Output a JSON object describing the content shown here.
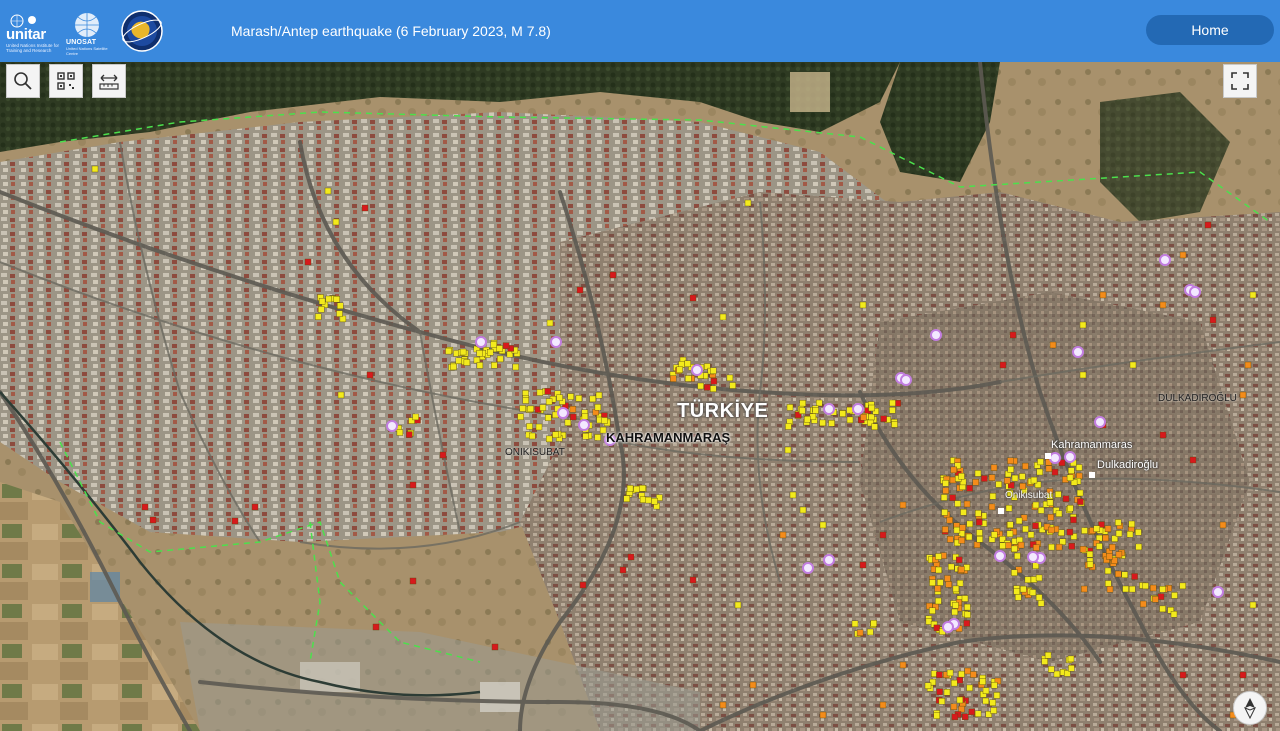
{
  "header": {
    "title": "Marash/Antep earthquake (6 February 2023, M 7.8)",
    "home_label": "Home",
    "logos": {
      "unitar_wordmark": "unitar",
      "unitar_tagline": "United Nations Institute for Training and Research",
      "unosat_wordmark": "UNOSAT",
      "unosat_tagline": "United Nations Satellite Centre"
    }
  },
  "toolbar": {
    "icons": [
      "search-icon",
      "qr-code-icon",
      "measure-icon"
    ],
    "fullscreen_icon": "fullscreen-icon",
    "compass_icon": "compass-icon"
  },
  "map": {
    "labels": {
      "country": "TÜRKİYE",
      "city": "KAHRAMANMARAŞ",
      "onikisubat_west": "ONIKISUBAT",
      "kahramanmaras": "Kahramanmaras",
      "dulkadiroglu": "Dulkadiroğlu",
      "onikisubat_center": "Onikisubat",
      "dulkadiroglu_caps": "DULKADIROĞLU"
    },
    "colors": {
      "damage_destroyed": "#d7191c",
      "damage_severe": "#f48c1a",
      "damage_moderate": "#f3ea1c",
      "place_marker": "#c27de0",
      "boundary": "#4ce04c"
    }
  }
}
